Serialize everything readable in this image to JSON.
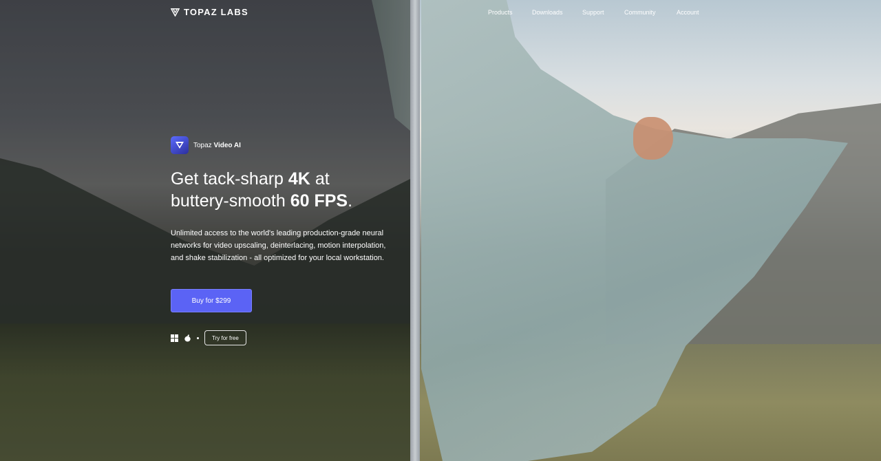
{
  "nav": {
    "logo_text": "TOPAZ LABS",
    "links": [
      {
        "label": "Products"
      },
      {
        "label": "Downloads"
      },
      {
        "label": "Support"
      },
      {
        "label": "Community"
      },
      {
        "label": "Account"
      }
    ]
  },
  "hero": {
    "product_brand": "Topaz",
    "product_name": "Video AI",
    "headline_part1": "Get tack-sharp ",
    "headline_bold1": "4K",
    "headline_part2": " at",
    "headline_part3": "buttery-smooth ",
    "headline_bold2": "60 FPS",
    "headline_part4": ".",
    "description": "Unlimited access to the world's leading production-grade neural networks for video upscaling, deinterlacing, motion interpolation, and shake stabilization - all optimized for your local workstation.",
    "buy_label": "Buy for $299",
    "try_label": "Try for free",
    "os_icons": [
      "windows-icon",
      "apple-icon"
    ]
  },
  "colors": {
    "accent": "#5b63f5"
  }
}
